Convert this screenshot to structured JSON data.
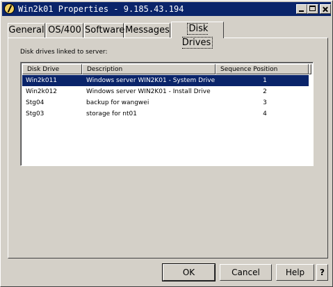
{
  "window": {
    "title": "Win2k01 Properties - 9.185.43.194"
  },
  "tabs": [
    {
      "label": "General"
    },
    {
      "label": "OS/400"
    },
    {
      "label": "Software"
    },
    {
      "label": "Messages"
    },
    {
      "label": "Disk Drives",
      "active": true
    }
  ],
  "panel": {
    "caption": "Disk drives linked to server:"
  },
  "table": {
    "columns": [
      "Disk Drive",
      "Description",
      "Sequence Position"
    ],
    "rows": [
      {
        "drive": "Win2k011",
        "description": "Windows server WIN2K01  - System Drive",
        "position": "1",
        "selected": true
      },
      {
        "drive": "Win2k012",
        "description": "Windows server WIN2K01  - Install Drive",
        "position": "2"
      },
      {
        "drive": "Stg04",
        "description": "backup for wangwei",
        "position": "3"
      },
      {
        "drive": "Stg03",
        "description": "storage for nt01",
        "position": "4"
      }
    ]
  },
  "buttons": {
    "ok": "OK",
    "cancel": "Cancel",
    "help": "Help",
    "question": "?"
  },
  "colors": {
    "titlebar": "#0a246a",
    "selection": "#0a246a",
    "face": "#d4d0c8"
  }
}
